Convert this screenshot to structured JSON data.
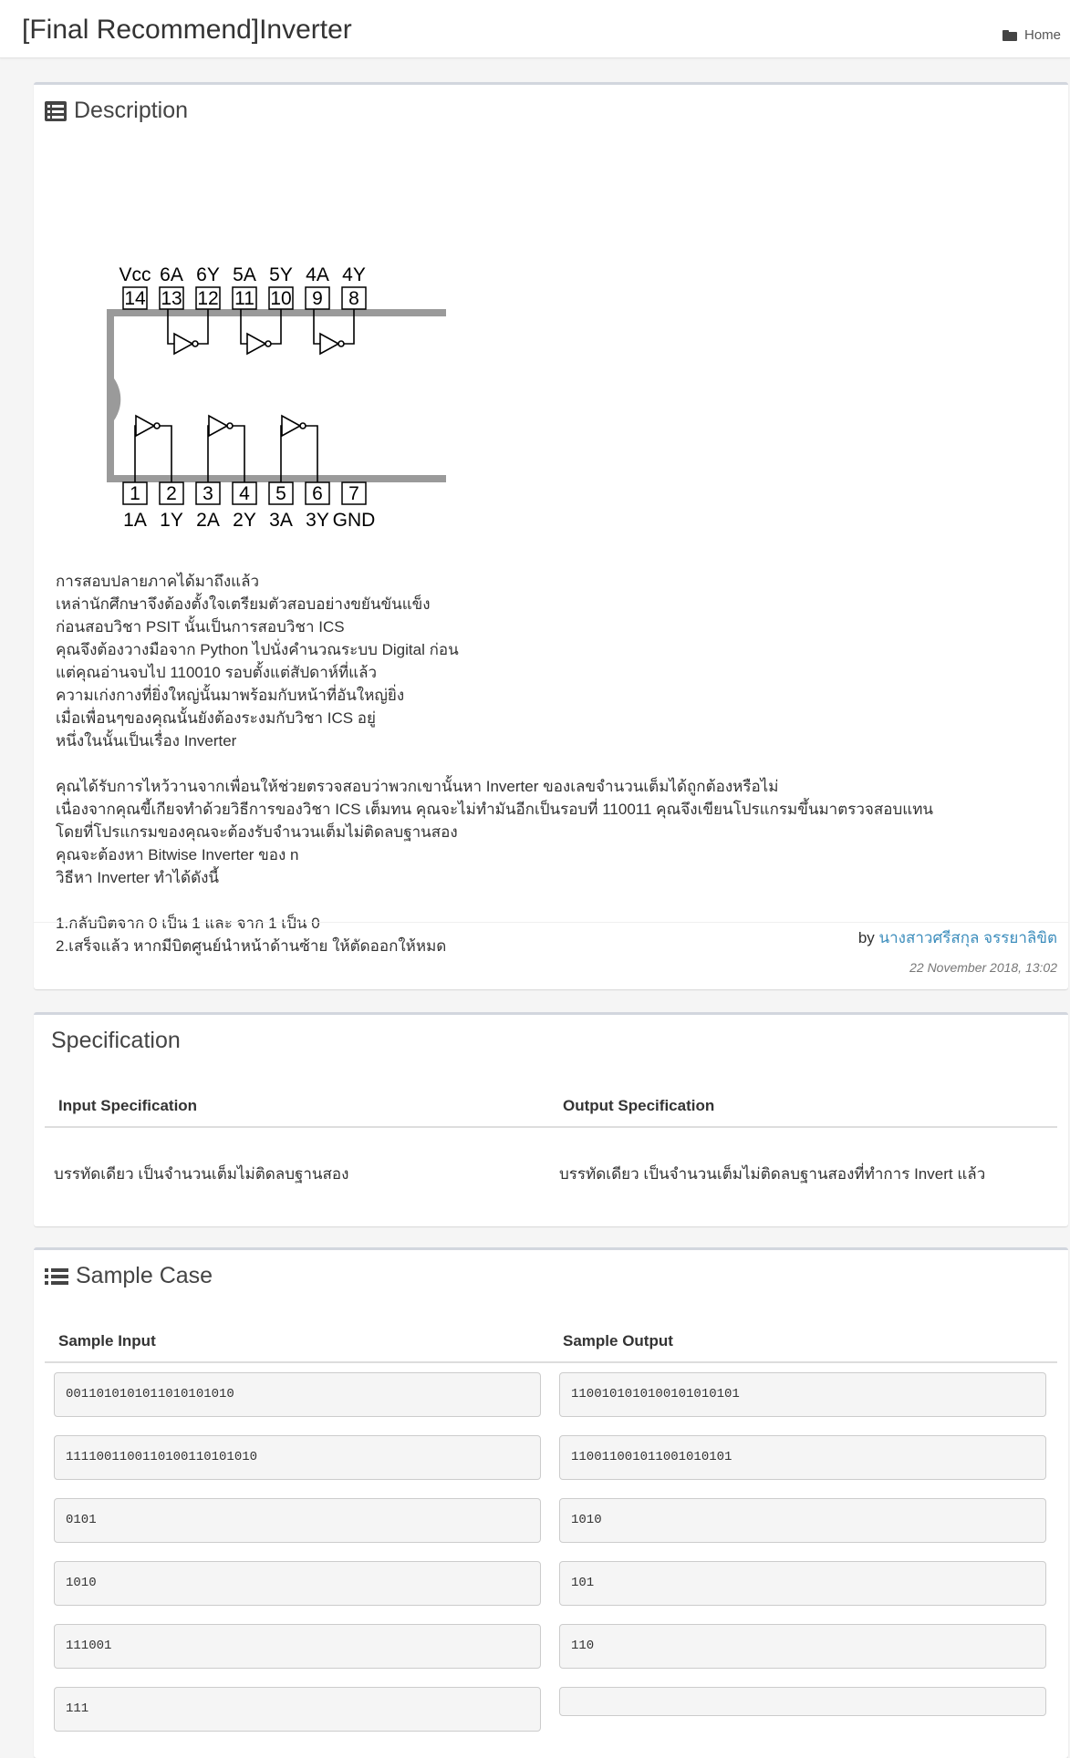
{
  "header": {
    "title": "[Final Recommend]Inverter",
    "home_label": "Home"
  },
  "description": {
    "heading": "Description",
    "chip": {
      "top_labels": [
        "Vcc",
        "6A",
        "6Y",
        "5A",
        "5Y",
        "4A",
        "4Y"
      ],
      "top_pins": [
        "14",
        "13",
        "12",
        "11",
        "10",
        "9",
        "8"
      ],
      "bottom_pins": [
        "1",
        "2",
        "3",
        "4",
        "5",
        "6",
        "7"
      ],
      "bottom_labels": [
        "1A",
        "1Y",
        "2A",
        "2Y",
        "3A",
        "3Y",
        "GND"
      ]
    },
    "paragraph1": [
      "การสอบปลายภาคได้มาถึงแล้ว",
      "เหล่านักศึกษาจึงต้องตั้งใจเตรียมตัวสอบอย่างขยันขันแข็ง",
      "ก่อนสอบวิชา PSIT นั้นเป็นการสอบวิชา ICS",
      "คุณจึงต้องวางมือจาก Python ไปนั่งคำนวณระบบ Digital ก่อน",
      "แต่คุณอ่านจบไป 110010 รอบตั้งแต่สัปดาห์ที่แล้ว",
      "ความเก่งกางที่ยิ่งใหญ่นั้นมาพร้อมกับหน้าที่อันใหญ่ยิ่ง",
      "เมื่อเพื่อนๆของคุณนั้นยังต้องระงมกับวิชา ICS อยู่",
      "หนึ่งในนั้นเป็นเรื่อง Inverter"
    ],
    "paragraph2": [
      "คุณได้รับการไหว้วานจากเพื่อนให้ช่วยตรวจสอบว่าพวกเขานั้นหา Inverter ของเลขจำนวนเต็มได้ถูกต้องหรือไม่",
      "เนื่องจากคุณขี้เกียจทำด้วยวิธีการของวิชา ICS เต็มทน คุณจะไม่ทำมันอีกเป็นรอบที่ 110011 คุณจึงเขียนโปรแกรมขึ้นมาตรวจสอบแทน",
      "โดยที่โปรแกรมของคุณจะต้องรับจำนวนเต็มไม่ติดลบฐานสอง",
      "คุณจะต้องหา Bitwise Inverter ของ n",
      "วิธีหา Inverter ทำได้ดังนี้"
    ],
    "paragraph3": [
      "1.กลับบิตจาก 0 เป็น 1 และ จาก 1 เป็น 0",
      "2.เสร็จแล้ว หากมีบิตศูนย์นำหน้าด้านซ้าย ให้ตัดออกให้หมด"
    ],
    "by_prefix": "by",
    "author": "นางสาวศรีสกุล จรรยาลิขิต",
    "date": "22 November 2018, 13:02"
  },
  "specification": {
    "heading": "Specification",
    "input_header": "Input Specification",
    "output_header": "Output Specification",
    "input_text": "บรรทัดเดียว เป็นจำนวนเต็มไม่ติดลบฐานสอง",
    "output_text": "บรรทัดเดียว เป็นจำนวนเต็มไม่ติดลบฐานสองที่ทำการ Invert แล้ว"
  },
  "sample_case": {
    "heading": "Sample Case",
    "input_header": "Sample Input",
    "output_header": "Sample Output",
    "rows": [
      {
        "input": "0011010101011010101010",
        "output": "1100101010100101010101"
      },
      {
        "input": "111100110011010011010101​0",
        "output": "11001100101100101010​1"
      },
      {
        "input": "0101",
        "output": "1010"
      },
      {
        "input": "1010",
        "output": "101"
      },
      {
        "input": "111001",
        "output": "110"
      },
      {
        "input": "111",
        "output": ""
      }
    ]
  }
}
